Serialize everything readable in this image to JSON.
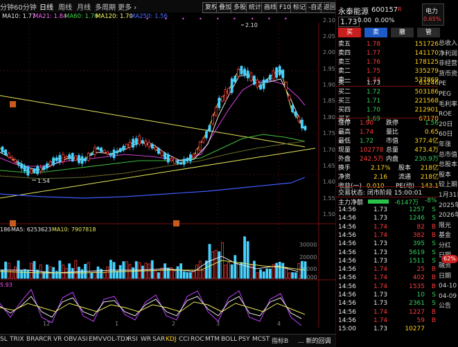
{
  "topbar": {
    "tabs": [
      "分钟",
      "60分钟",
      "日线",
      "周线",
      "月线",
      "多周期",
      "更多 ›"
    ],
    "active_tab": "日线",
    "buttons": [
      "复权",
      "叠加",
      "多股",
      "统计",
      "画线",
      "F10",
      "标记",
      "-自选",
      "返回"
    ]
  },
  "ma_legend": {
    "ma10": "MA10: 1.77",
    "ma21": "MA21: 1.84",
    "ma60": "MA60: 1.76",
    "ma120": "MA120: 1.70",
    "ma250": "MA250: 1.56"
  },
  "price_axis": [
    "2.10",
    "2.05",
    "2.00",
    "1.95",
    "1.90",
    "1.85",
    "1.80",
    "1.75",
    "1.70",
    "1.65",
    "1.60",
    "1.55",
    "1.50"
  ],
  "annotations": {
    "high": "2.10",
    "low": "1.54"
  },
  "volume_legend": {
    "vol": "186",
    "ma5": "MA5: 6253623",
    "ma10": "MA10: 7907818"
  },
  "volume_axis": [
    "30000",
    "20000",
    "10000",
    "X1000"
  ],
  "indicator_value": "5.93",
  "month_marks": [
    "12",
    "1",
    "2",
    "3",
    "4"
  ],
  "bottombar": {
    "tabs": [
      "SL",
      "TRIX",
      "BRAR",
      "CR",
      "VR",
      "OBV",
      "ASI",
      "EMV",
      "VOL-TDX",
      "RSI",
      "WR",
      "SAR",
      "KDJ",
      "CCI",
      "ROC",
      "MTM",
      "BOLL",
      "PSY",
      "MCST",
      "指标B"
    ],
    "active_tab": "KDJ",
    "overflow": "... 新的回调"
  },
  "quote": {
    "name": "永泰能源",
    "code": "600157",
    "badge": "R",
    "sector": "电力",
    "sector_pct": "0.65%",
    "price": "1.73",
    "change": "0.00",
    "change_pct": "0.00%",
    "buttons": [
      "买",
      "卖",
      "撤",
      "管"
    ],
    "asks": [
      {
        "label": "卖五",
        "price": "1.78",
        "vol": "151726"
      },
      {
        "label": "卖四",
        "price": "1.77",
        "vol": "141170"
      },
      {
        "label": "卖三",
        "price": "1.76",
        "vol": "178125"
      },
      {
        "label": "卖二",
        "price": "1.75",
        "vol": "335279"
      },
      {
        "label": "卖一",
        "price": "1.74",
        "vol": "537869"
      }
    ],
    "bids": [
      {
        "label": "买一",
        "price": "1.73",
        "vol": "63246"
      },
      {
        "label": "买二",
        "price": "1.72",
        "vol": "503186"
      },
      {
        "label": "买三",
        "price": "1.71",
        "vol": "221568"
      },
      {
        "label": "买四",
        "price": "1.70",
        "vol": "212901"
      },
      {
        "label": "买五",
        "price": "1.69",
        "vol": "67178"
      }
    ],
    "stats": [
      {
        "l1": "涨停",
        "v1": "1.90",
        "l2": "跌停",
        "v2": "1.56"
      },
      {
        "l1": "最高",
        "v1": "1.74",
        "l2": "量比",
        "v2": "0.65"
      },
      {
        "l1": "最低",
        "v1": "1.72",
        "l2": "市值",
        "v2": "377.4亿"
      },
      {
        "l1": "现量",
        "v1": "102778",
        "l2": "总量",
        "v2": "473.4万"
      },
      {
        "l1": "外盘",
        "v1": "242.5万",
        "l2": "内盘",
        "v2": "230.9万"
      },
      {
        "l1": "换手",
        "v1": "2.17%",
        "l2": "股本",
        "v2": "218亿"
      },
      {
        "l1": "净资",
        "v1": "2.16",
        "l2": "流通",
        "v2": "218亿"
      },
      {
        "l1": "收益(一)",
        "v1": "0.010",
        "l2": "PE(动)",
        "v2": "143.1"
      }
    ],
    "status": "交易状态: 闭市阶段 15:00:01",
    "net_flow_label": "主力净额",
    "net_flow_value": "-6147万",
    "net_flow_pct": "-8%",
    "ticks": [
      {
        "t": "14:56",
        "p": "1.73",
        "v": "1257",
        "s": "S"
      },
      {
        "t": "14:56",
        "p": "1.73",
        "v": "1246",
        "s": "S"
      },
      {
        "t": "14:56",
        "p": "1.74",
        "v": "82",
        "s": "B"
      },
      {
        "t": "14:56",
        "p": "1.74",
        "v": "382",
        "s": "B"
      },
      {
        "t": "14:56",
        "p": "1.73",
        "v": "395",
        "s": "S"
      },
      {
        "t": "14:56",
        "p": "1.73",
        "v": "5619",
        "s": "S"
      },
      {
        "t": "14:56",
        "p": "1.73",
        "v": "1511",
        "s": "S"
      },
      {
        "t": "14:56",
        "p": "1.74",
        "v": "25",
        "s": "B"
      },
      {
        "t": "14:56",
        "p": "1.74",
        "v": "402",
        "s": "B"
      },
      {
        "t": "14:56",
        "p": "1.74",
        "v": "1535",
        "s": "B"
      },
      {
        "t": "14:56",
        "p": "1.73",
        "v": "10",
        "s": "S"
      },
      {
        "t": "14:56",
        "p": "1.73",
        "v": "2361",
        "s": "S"
      },
      {
        "t": "14:56",
        "p": "1.74",
        "v": "1227",
        "s": "B"
      },
      {
        "t": "14:56",
        "p": "1.74",
        "v": "59",
        "s": "B"
      },
      {
        "t": "15:00",
        "p": "1.73",
        "v": "10277",
        "s": ""
      }
    ]
  },
  "side_column": [
    "总收入",
    "净利润",
    "非经营",
    "货币资金",
    "PE",
    "PEG",
    "毛利率",
    "ROE",
    "20日",
    "60日",
    "年涨",
    "总市值",
    "总股本",
    "股本",
    "较上期",
    "1月31日",
    "2025年",
    "2026年",
    "限光",
    "基金",
    "分红",
    "日期",
    "融资",
    "日期",
    "04-10",
    "04-09",
    "公告"
  ],
  "side_badge": "62%"
}
